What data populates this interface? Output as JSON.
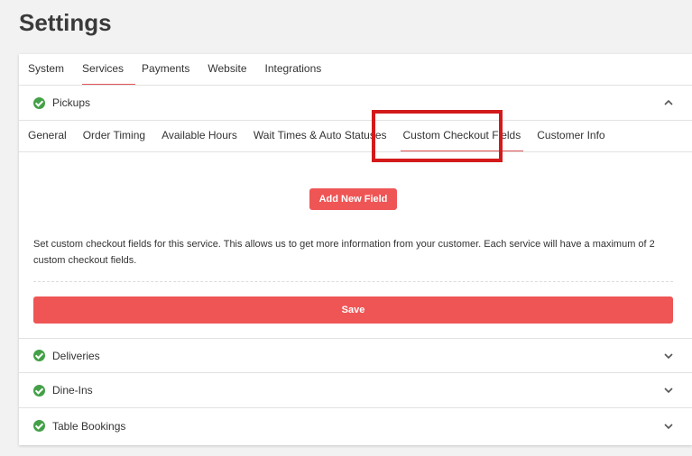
{
  "page": {
    "title": "Settings"
  },
  "top_tabs": [
    {
      "label": "System"
    },
    {
      "label": "Services"
    },
    {
      "label": "Payments"
    },
    {
      "label": "Website"
    },
    {
      "label": "Integrations"
    }
  ],
  "active_top_tab": "Services",
  "sections": {
    "pickups": {
      "label": "Pickups",
      "expanded": true
    },
    "deliveries": {
      "label": "Deliveries"
    },
    "dine_ins": {
      "label": "Dine-Ins"
    },
    "table_bookings": {
      "label": "Table Bookings"
    }
  },
  "sub_tabs": [
    {
      "label": "General"
    },
    {
      "label": "Order Timing"
    },
    {
      "label": "Available Hours"
    },
    {
      "label": "Wait Times & Auto Statuses"
    },
    {
      "label": "Custom Checkout Fields"
    },
    {
      "label": "Customer Info"
    }
  ],
  "active_sub_tab": "Custom Checkout Fields",
  "content": {
    "add_button": "Add New Field",
    "description": "Set custom checkout fields for this service. This allows us to get more information from your customer. Each service will have a maximum of 2 custom checkout fields.",
    "save_button": "Save"
  },
  "colors": {
    "accent": "#ef5555",
    "check": "#43a047",
    "highlight": "#d31a1a"
  },
  "icons": {
    "status": "check-circle-icon",
    "expand": "chevron-down-icon",
    "collapse": "chevron-up-icon"
  }
}
